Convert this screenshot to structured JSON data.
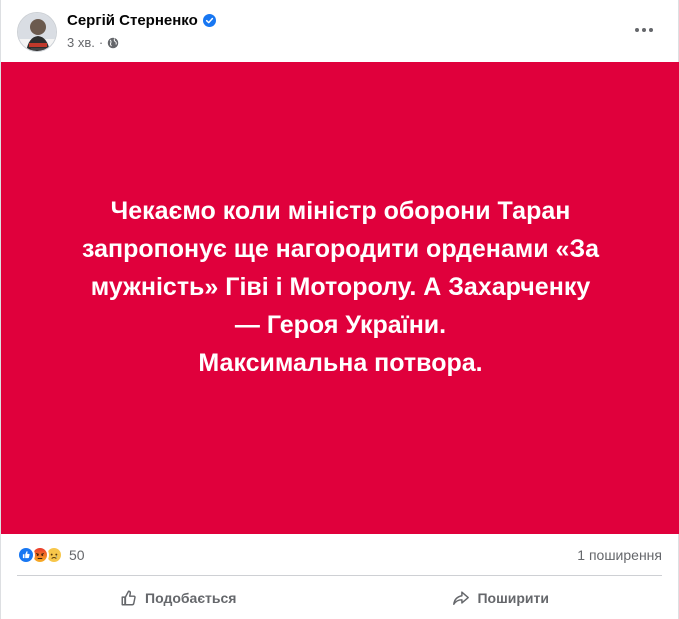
{
  "post": {
    "author": "Сергій Стерненко",
    "time": "3 хв.",
    "separator": "·",
    "media": {
      "background": "#e0003c",
      "lines": [
        "Чекаємо коли міністр оборони Таран",
        "запропонує ще нагородити орденами «За",
        "мужність» Гіві і Моторолу. А Захарченку",
        "— Героя України.",
        "Максимальна потвора."
      ]
    },
    "reactions": {
      "icons": [
        "like-icon",
        "angry-icon",
        "sad-icon"
      ],
      "count": "50"
    },
    "shares": "1 поширення",
    "actions": {
      "like": "Подобається",
      "share": "Поширити"
    }
  }
}
